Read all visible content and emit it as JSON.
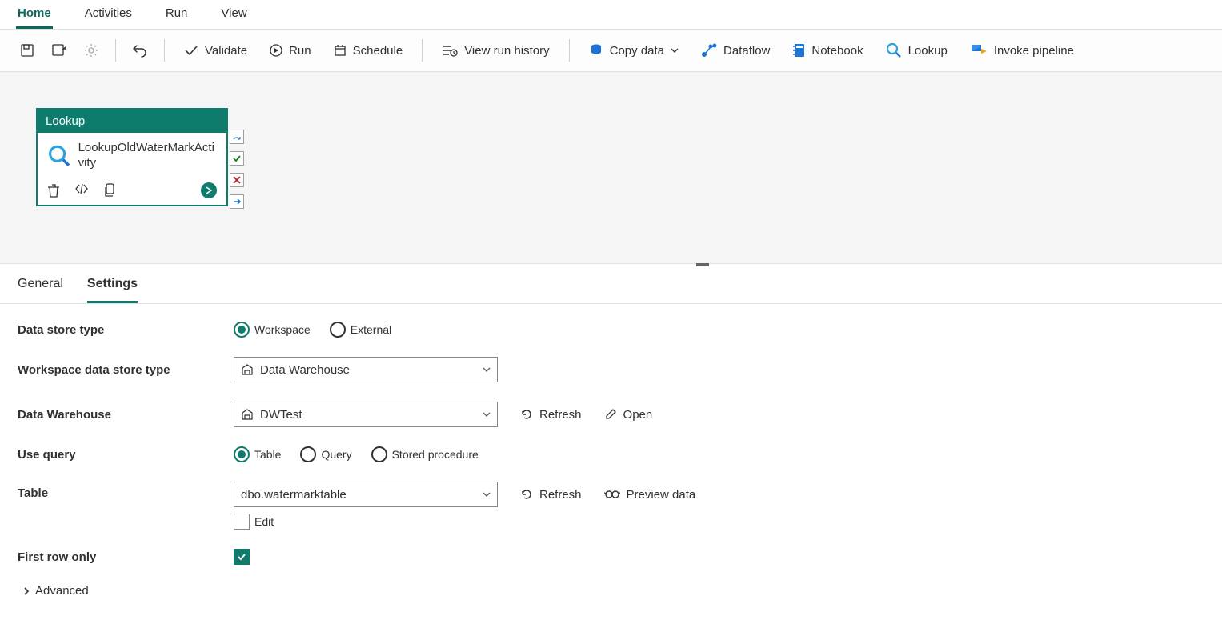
{
  "topTabs": {
    "home": "Home",
    "activities": "Activities",
    "run": "Run",
    "view": "View"
  },
  "toolbar": {
    "validate": "Validate",
    "run": "Run",
    "schedule": "Schedule",
    "viewHistory": "View run history",
    "copyData": "Copy data",
    "dataflow": "Dataflow",
    "notebook": "Notebook",
    "lookup": "Lookup",
    "invokePipeline": "Invoke pipeline"
  },
  "activity": {
    "type": "Lookup",
    "name": "LookupOldWaterMarkActivity"
  },
  "propTabs": {
    "general": "General",
    "settings": "Settings"
  },
  "form": {
    "dataStoreTypeLabel": "Data store type",
    "dataStoreType": {
      "workspace": "Workspace",
      "external": "External"
    },
    "wsDataStoreTypeLabel": "Workspace data store type",
    "wsDataStoreTypeValue": "Data Warehouse",
    "dwLabel": "Data Warehouse",
    "dwValue": "DWTest",
    "refresh": "Refresh",
    "open": "Open",
    "useQueryLabel": "Use query",
    "useQuery": {
      "table": "Table",
      "query": "Query",
      "storedProc": "Stored procedure"
    },
    "tableLabel": "Table",
    "tableValue": "dbo.watermarktable",
    "previewData": "Preview data",
    "edit": "Edit",
    "firstRowOnlyLabel": "First row only",
    "advanced": "Advanced"
  }
}
